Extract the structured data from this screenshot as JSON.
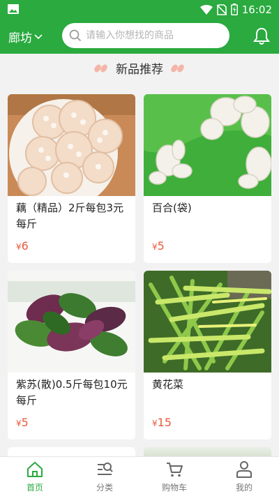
{
  "status_bar": {
    "time": "16:02"
  },
  "header": {
    "city": "廊坊",
    "search_placeholder": "请输入你想找的商品"
  },
  "section": {
    "title": "新品推荐"
  },
  "products": [
    {
      "name": "藕（精品）2斤每包3元每斤",
      "currency": "¥",
      "price": "6"
    },
    {
      "name": "百合(袋)",
      "currency": "¥",
      "price": "5"
    },
    {
      "name": "紫苏(散)0.5斤每包10元每斤",
      "currency": "¥",
      "price": "5"
    },
    {
      "name": "黄花菜",
      "currency": "¥",
      "price": "15"
    }
  ],
  "tabbar": {
    "items": [
      {
        "label": "首页",
        "icon": "home-icon",
        "active": true
      },
      {
        "label": "分类",
        "icon": "category-search-icon",
        "active": false
      },
      {
        "label": "购物车",
        "icon": "cart-icon",
        "active": false
      },
      {
        "label": "我的",
        "icon": "user-icon",
        "active": false
      }
    ]
  },
  "colors": {
    "brand_green": "#2aaa3f",
    "price_red": "#e85a3c"
  }
}
